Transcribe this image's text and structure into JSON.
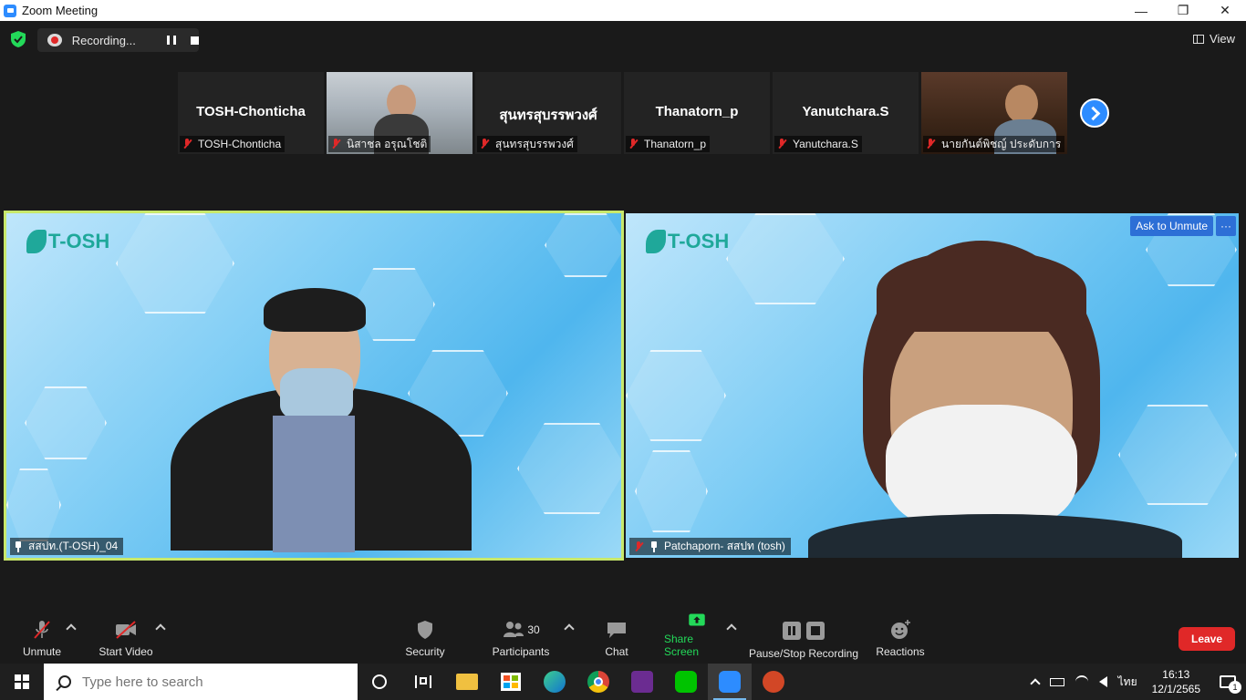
{
  "window": {
    "title": "Zoom Meeting",
    "minimize_glyph": "—",
    "restore_glyph": "❐",
    "close_glyph": "✕"
  },
  "topbar": {
    "security_icon": "shield-check-icon",
    "security_color": "#23d959",
    "recording_label": "Recording...",
    "view_label": "View"
  },
  "thumbnails": [
    {
      "display_name": "TOSH-Chonticha",
      "label": "TOSH-Chonticha",
      "video": false
    },
    {
      "display_name": "",
      "label": "นิสาชล อรุณโชติ",
      "video": true
    },
    {
      "display_name": "สุนทรสุบรรพวงศ์",
      "label": "สุนทรสุบรรพวงศ์",
      "video": false
    },
    {
      "display_name": "Thanatorn_p",
      "label": "Thanatorn_p",
      "video": false
    },
    {
      "display_name": "Yanutchara.S",
      "label": "Yanutchara.S",
      "video": false
    },
    {
      "display_name": "",
      "label": "นายกันต์พิชญ์ ประดับการ",
      "video": true
    }
  ],
  "tiles": {
    "left": {
      "logo": "T-OSH",
      "label": "สสปท.(T-OSH)_04",
      "active_border": "#c8e86b"
    },
    "right": {
      "logo": "T-OSH",
      "label": "Patchaporn- สสปท (tosh)",
      "ask_unmute": "Ask to Unmute",
      "more": "···"
    }
  },
  "toolbar": {
    "unmute": "Unmute",
    "start_video": "Start Video",
    "security": "Security",
    "participants": "Participants",
    "participants_count": "30",
    "chat": "Chat",
    "share_screen": "Share Screen",
    "share_color": "#23d959",
    "pause_stop_recording": "Pause/Stop Recording",
    "reactions": "Reactions",
    "leave": "Leave",
    "leave_color": "#e02828"
  },
  "taskbar": {
    "search_placeholder": "Type here to search",
    "apps": [
      "cortana-icon",
      "task-view-icon",
      "file-explorer-icon",
      "store-icon",
      "edge-icon",
      "chrome-icon",
      "pdf-app-icon",
      "line-icon",
      "zoom-icon",
      "powerpoint-icon"
    ],
    "input_language": "ไทย",
    "time": "16:13",
    "date": "12/1/2565",
    "notification_count": "1"
  }
}
